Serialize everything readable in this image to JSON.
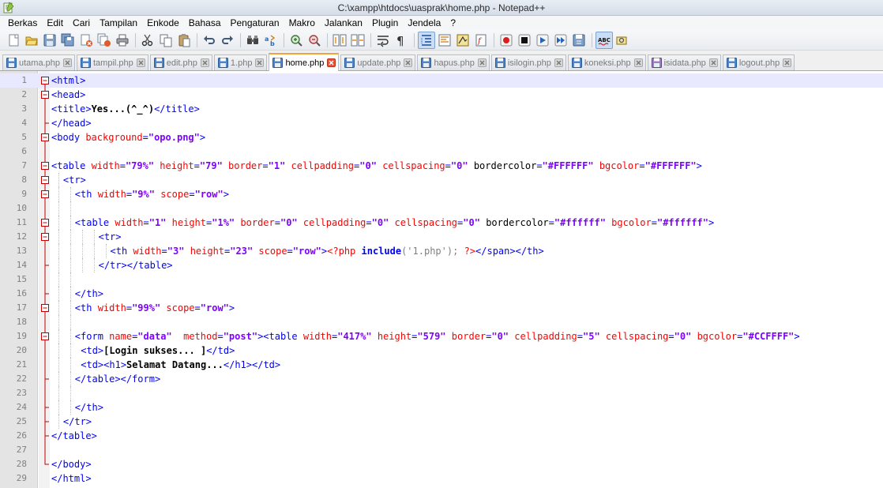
{
  "window": {
    "title": "C:\\xampp\\htdocs\\uasprak\\home.php - Notepad++"
  },
  "menu": [
    "Berkas",
    "Edit",
    "Cari",
    "Tampilan",
    "Enkode",
    "Bahasa",
    "Pengaturan",
    "Makro",
    "Jalankan",
    "Plugin",
    "Jendela",
    "?"
  ],
  "toolbar": [
    {
      "icon": "new-file-icon"
    },
    {
      "icon": "open-file-icon"
    },
    {
      "icon": "save-icon"
    },
    {
      "icon": "save-all-icon"
    },
    {
      "icon": "close-file-icon"
    },
    {
      "icon": "close-all-icon"
    },
    {
      "icon": "print-icon"
    },
    {
      "sep": true
    },
    {
      "icon": "cut-icon"
    },
    {
      "icon": "copy-icon"
    },
    {
      "icon": "paste-icon"
    },
    {
      "sep": true
    },
    {
      "icon": "undo-icon"
    },
    {
      "icon": "redo-icon"
    },
    {
      "sep": true
    },
    {
      "icon": "find-icon"
    },
    {
      "icon": "replace-icon"
    },
    {
      "sep": true
    },
    {
      "icon": "zoom-in-icon"
    },
    {
      "icon": "zoom-out-icon"
    },
    {
      "sep": true
    },
    {
      "icon": "sync-vertical-icon"
    },
    {
      "icon": "sync-horizontal-icon"
    },
    {
      "sep": true
    },
    {
      "icon": "word-wrap-icon"
    },
    {
      "icon": "show-all-chars-icon"
    },
    {
      "sep": true
    },
    {
      "icon": "indent-guide-icon",
      "active": true
    },
    {
      "icon": "udl-icon"
    },
    {
      "icon": "doc-map-icon"
    },
    {
      "icon": "function-list-icon"
    },
    {
      "sep": true
    },
    {
      "icon": "record-macro-icon"
    },
    {
      "icon": "stop-macro-icon"
    },
    {
      "icon": "play-macro-icon"
    },
    {
      "icon": "run-macro-multiple-icon"
    },
    {
      "icon": "save-macro-icon"
    },
    {
      "sep": true
    },
    {
      "icon": "spell-check-icon",
      "active": true
    },
    {
      "icon": "spell-settings-icon"
    }
  ],
  "tabs": [
    {
      "label": "utama.php",
      "active": false
    },
    {
      "label": "tampil.php",
      "active": false
    },
    {
      "label": "edit.php",
      "active": false
    },
    {
      "label": "1.php",
      "active": false
    },
    {
      "label": "home.php",
      "active": true
    },
    {
      "label": "update.php",
      "active": false
    },
    {
      "label": "hapus.php",
      "active": false
    },
    {
      "label": "isilogin.php",
      "active": false
    },
    {
      "label": "koneksi.php",
      "active": false
    },
    {
      "label": "isidata.php",
      "active": false
    },
    {
      "label": "logout.php",
      "active": false
    }
  ],
  "editor": {
    "current_line": 1,
    "lines": [
      {
        "n": "1",
        "fold": "box-top",
        "indent": 0,
        "tokens": [
          [
            "tg",
            "<html>"
          ]
        ]
      },
      {
        "n": "2",
        "fold": "box",
        "indent": 0,
        "tokens": [
          [
            "tg",
            "<head>"
          ]
        ]
      },
      {
        "n": "3",
        "fold": "line",
        "indent": 0,
        "tokens": [
          [
            "tg",
            "<title>"
          ],
          [
            "txt",
            "Yes...(^_^)"
          ],
          [
            "tg",
            "</title>"
          ]
        ]
      },
      {
        "n": "4",
        "fold": "end",
        "indent": 0,
        "tokens": [
          [
            "tg",
            "</head>"
          ]
        ]
      },
      {
        "n": "5",
        "fold": "box",
        "indent": 0,
        "tokens": [
          [
            "tg",
            "<body "
          ],
          [
            "at",
            "background"
          ],
          [
            "tg",
            "="
          ],
          [
            "vl",
            "\"opo.png\""
          ],
          [
            "tg",
            ">"
          ]
        ]
      },
      {
        "n": "6",
        "fold": "line",
        "indent": 0,
        "tokens": []
      },
      {
        "n": "7",
        "fold": "box",
        "indent": 0,
        "tokens": [
          [
            "tg",
            "<table "
          ],
          [
            "at",
            "width"
          ],
          [
            "tg",
            "="
          ],
          [
            "vl",
            "\"79%\""
          ],
          [
            "tg",
            " "
          ],
          [
            "at",
            "height"
          ],
          [
            "tg",
            "="
          ],
          [
            "vl",
            "\"79\""
          ],
          [
            "tg",
            " "
          ],
          [
            "at",
            "border"
          ],
          [
            "tg",
            "="
          ],
          [
            "vl",
            "\"1\""
          ],
          [
            "tg",
            " "
          ],
          [
            "at",
            "cellpadding"
          ],
          [
            "tg",
            "="
          ],
          [
            "vl",
            "\"0\""
          ],
          [
            "tg",
            " "
          ],
          [
            "at",
            "cellspacing"
          ],
          [
            "tg",
            "="
          ],
          [
            "vl",
            "\"0\""
          ],
          [
            "tg",
            " "
          ],
          [
            "txtn",
            "bordercolor"
          ],
          [
            "tg",
            "="
          ],
          [
            "vl",
            "\"#FFFFFF\""
          ],
          [
            "tg",
            " "
          ],
          [
            "at",
            "bgcolor"
          ],
          [
            "tg",
            "="
          ],
          [
            "vl",
            "\"#FFFFFF\""
          ],
          [
            "tg",
            ">"
          ]
        ]
      },
      {
        "n": "8",
        "fold": "box",
        "indent": 1,
        "tokens": [
          [
            "tg",
            "<tr>"
          ]
        ]
      },
      {
        "n": "9",
        "fold": "box",
        "indent": 2,
        "tokens": [
          [
            "tg",
            "<th "
          ],
          [
            "at",
            "width"
          ],
          [
            "tg",
            "="
          ],
          [
            "vl",
            "\"9%\""
          ],
          [
            "tg",
            " "
          ],
          [
            "at",
            "scope"
          ],
          [
            "tg",
            "="
          ],
          [
            "vl",
            "\"row\""
          ],
          [
            "tg",
            ">"
          ]
        ]
      },
      {
        "n": "10",
        "fold": "line",
        "indent": 2,
        "tokens": []
      },
      {
        "n": "11",
        "fold": "box",
        "indent": 2,
        "tokens": [
          [
            "tg",
            "<table "
          ],
          [
            "at",
            "width"
          ],
          [
            "tg",
            "="
          ],
          [
            "vl",
            "\"1\""
          ],
          [
            "tg",
            " "
          ],
          [
            "at",
            "height"
          ],
          [
            "tg",
            "="
          ],
          [
            "vl",
            "\"1%\""
          ],
          [
            "tg",
            " "
          ],
          [
            "at",
            "border"
          ],
          [
            "tg",
            "="
          ],
          [
            "vl",
            "\"0\""
          ],
          [
            "tg",
            " "
          ],
          [
            "at",
            "cellpadding"
          ],
          [
            "tg",
            "="
          ],
          [
            "vl",
            "\"0\""
          ],
          [
            "tg",
            " "
          ],
          [
            "at",
            "cellspacing"
          ],
          [
            "tg",
            "="
          ],
          [
            "vl",
            "\"0\""
          ],
          [
            "tg",
            " "
          ],
          [
            "txtn",
            "bordercolor"
          ],
          [
            "tg",
            "="
          ],
          [
            "vl",
            "\"#ffffff\""
          ],
          [
            "tg",
            " "
          ],
          [
            "at",
            "bgcolor"
          ],
          [
            "tg",
            "="
          ],
          [
            "vl",
            "\"#ffffff\""
          ],
          [
            "tg",
            ">"
          ]
        ]
      },
      {
        "n": "12",
        "fold": "box",
        "indent": 4,
        "tokens": [
          [
            "tg",
            "<tr>"
          ]
        ]
      },
      {
        "n": "13",
        "fold": "line",
        "indent": 5,
        "tokens": [
          [
            "tg",
            "<th "
          ],
          [
            "at",
            "width"
          ],
          [
            "tg",
            "="
          ],
          [
            "vl",
            "\"3\""
          ],
          [
            "tg",
            " "
          ],
          [
            "at",
            "height"
          ],
          [
            "tg",
            "="
          ],
          [
            "vl",
            "\"23\""
          ],
          [
            "tg",
            " "
          ],
          [
            "at",
            "scope"
          ],
          [
            "tg",
            "="
          ],
          [
            "vl",
            "\"row\""
          ],
          [
            "tg",
            ">"
          ],
          [
            "php",
            "<?php "
          ],
          [
            "kw",
            "include"
          ],
          [
            "str",
            "('1.php'); "
          ],
          [
            "php",
            "?>"
          ],
          [
            "tg",
            "</span></th>"
          ]
        ]
      },
      {
        "n": "14",
        "fold": "end",
        "indent": 4,
        "tokens": [
          [
            "tg",
            "</tr></table>"
          ]
        ]
      },
      {
        "n": "15",
        "fold": "line",
        "indent": 2,
        "tokens": []
      },
      {
        "n": "16",
        "fold": "end",
        "indent": 2,
        "tokens": [
          [
            "tg",
            "</th>"
          ]
        ]
      },
      {
        "n": "17",
        "fold": "box",
        "indent": 2,
        "tokens": [
          [
            "tg",
            "<th "
          ],
          [
            "at",
            "width"
          ],
          [
            "tg",
            "="
          ],
          [
            "vl",
            "\"99%\""
          ],
          [
            "tg",
            " "
          ],
          [
            "at",
            "scope"
          ],
          [
            "tg",
            "="
          ],
          [
            "vl",
            "\"row\""
          ],
          [
            "tg",
            ">"
          ]
        ]
      },
      {
        "n": "18",
        "fold": "line",
        "indent": 2,
        "tokens": []
      },
      {
        "n": "19",
        "fold": "box",
        "indent": 2,
        "tokens": [
          [
            "tg",
            "<form "
          ],
          [
            "at",
            "name"
          ],
          [
            "tg",
            "="
          ],
          [
            "vl",
            "\"data\""
          ],
          [
            "tg",
            "  "
          ],
          [
            "at",
            "method"
          ],
          [
            "tg",
            "="
          ],
          [
            "vl",
            "\"post\""
          ],
          [
            "tg",
            "><table "
          ],
          [
            "at",
            "width"
          ],
          [
            "tg",
            "="
          ],
          [
            "vl",
            "\"417%\""
          ],
          [
            "tg",
            " "
          ],
          [
            "at",
            "height"
          ],
          [
            "tg",
            "="
          ],
          [
            "vl",
            "\"579\""
          ],
          [
            "tg",
            " "
          ],
          [
            "at",
            "border"
          ],
          [
            "tg",
            "="
          ],
          [
            "vl",
            "\"0\""
          ],
          [
            "tg",
            " "
          ],
          [
            "at",
            "cellpadding"
          ],
          [
            "tg",
            "="
          ],
          [
            "vl",
            "\"5\""
          ],
          [
            "tg",
            " "
          ],
          [
            "at",
            "cellspacing"
          ],
          [
            "tg",
            "="
          ],
          [
            "vl",
            "\"0\""
          ],
          [
            "tg",
            " "
          ],
          [
            "at",
            "bgcolor"
          ],
          [
            "tg",
            "="
          ],
          [
            "vl",
            "\"#CCFFFF\""
          ],
          [
            "tg",
            ">"
          ]
        ]
      },
      {
        "n": "20",
        "fold": "line",
        "indent": 2.5,
        "tokens": [
          [
            "tg",
            "<td>"
          ],
          [
            "txt",
            "[Login sukses... ]"
          ],
          [
            "tg",
            "</td>"
          ]
        ]
      },
      {
        "n": "21",
        "fold": "line",
        "indent": 2.5,
        "tokens": [
          [
            "tg",
            "<td><h1>"
          ],
          [
            "txt",
            "Selamat Datang..."
          ],
          [
            "tg",
            "</h1></td>"
          ]
        ]
      },
      {
        "n": "22",
        "fold": "end",
        "indent": 2,
        "tokens": [
          [
            "tg",
            "</table></form>"
          ]
        ]
      },
      {
        "n": "23",
        "fold": "line",
        "indent": 2,
        "tokens": []
      },
      {
        "n": "24",
        "fold": "end",
        "indent": 2,
        "tokens": [
          [
            "tg",
            "</th>"
          ]
        ]
      },
      {
        "n": "25",
        "fold": "end",
        "indent": 1,
        "tokens": [
          [
            "tg",
            "</tr>"
          ]
        ]
      },
      {
        "n": "26",
        "fold": "end",
        "indent": 0,
        "tokens": [
          [
            "tg",
            "</table>"
          ]
        ]
      },
      {
        "n": "27",
        "fold": "line",
        "indent": 0,
        "tokens": []
      },
      {
        "n": "28",
        "fold": "end",
        "indent": 0,
        "tokens": [
          [
            "tg",
            "</body>"
          ]
        ]
      },
      {
        "n": "29",
        "fold": "none",
        "indent": 0,
        "tokens": [
          [
            "tg",
            "</html>"
          ]
        ]
      }
    ]
  },
  "colors": {
    "tag": "#0000ff",
    "attribute": "#ff0000",
    "value": "#8000ff",
    "current_line": "#e8e8ff",
    "active_tab_accent": "#f4a23a"
  }
}
